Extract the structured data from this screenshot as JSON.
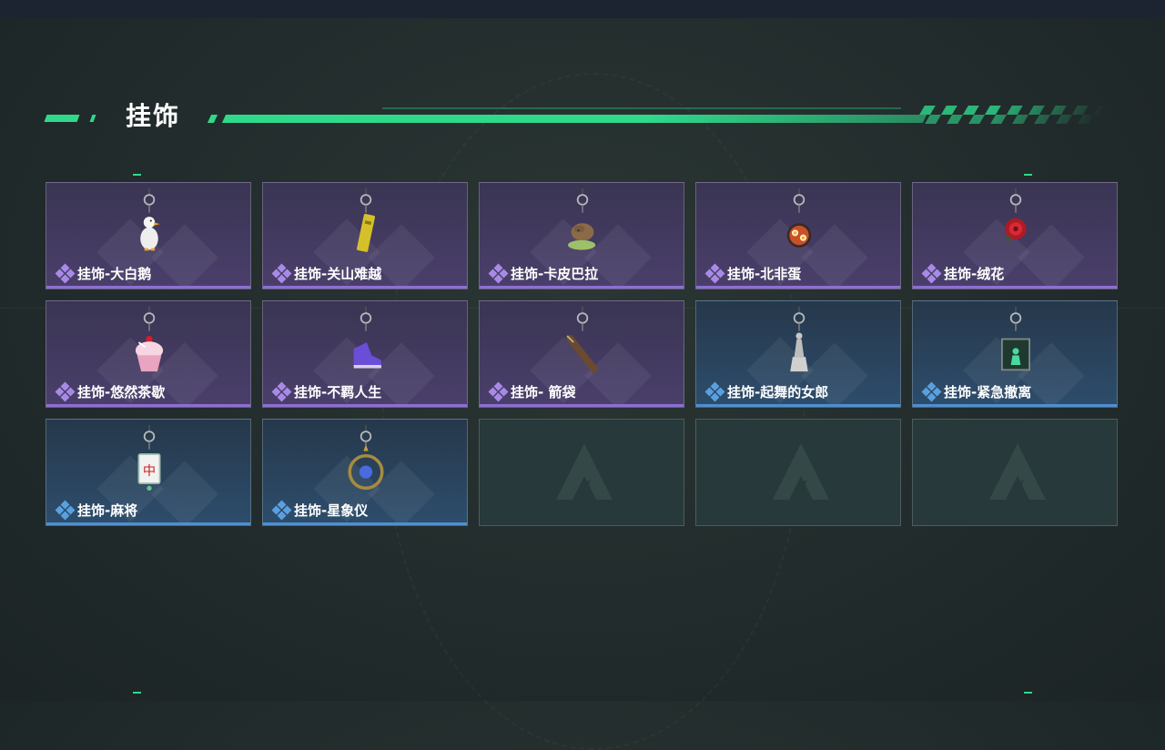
{
  "header": {
    "title": "挂饰"
  },
  "colors": {
    "accent": "#2fd98c",
    "epic": "#8d6ed4",
    "rare": "#4f8fd0"
  },
  "items": [
    {
      "label": "挂饰-大白鹅",
      "rarity": "purple",
      "icon": "goose-charm-icon"
    },
    {
      "label": "挂饰-关山难越",
      "rarity": "purple",
      "icon": "gold-bar-charm-icon"
    },
    {
      "label": "挂饰-卡皮巴拉",
      "rarity": "purple",
      "icon": "capybara-charm-icon"
    },
    {
      "label": "挂饰-北非蛋",
      "rarity": "purple",
      "icon": "shakshuka-pan-charm-icon"
    },
    {
      "label": "挂饰-绒花",
      "rarity": "purple",
      "icon": "red-flower-charm-icon"
    },
    {
      "label": "挂饰-悠然茶歇",
      "rarity": "purple",
      "icon": "cupcake-charm-icon"
    },
    {
      "label": "挂饰-不羁人生",
      "rarity": "purple",
      "icon": "sneaker-charm-icon"
    },
    {
      "label": "挂饰- 箭袋",
      "rarity": "purple",
      "icon": "quiver-charm-icon"
    },
    {
      "label": "挂饰-起舞的女郎",
      "rarity": "blue",
      "icon": "dancer-statue-charm-icon"
    },
    {
      "label": "挂饰-紧急撤离",
      "rarity": "blue",
      "icon": "exit-sign-charm-icon"
    },
    {
      "label": "挂饰-麻将",
      "rarity": "blue",
      "icon": "mahjong-tile-charm-icon"
    },
    {
      "label": "挂饰-星象仪",
      "rarity": "blue",
      "icon": "astrolabe-charm-icon"
    }
  ],
  "empty_slots": 3
}
